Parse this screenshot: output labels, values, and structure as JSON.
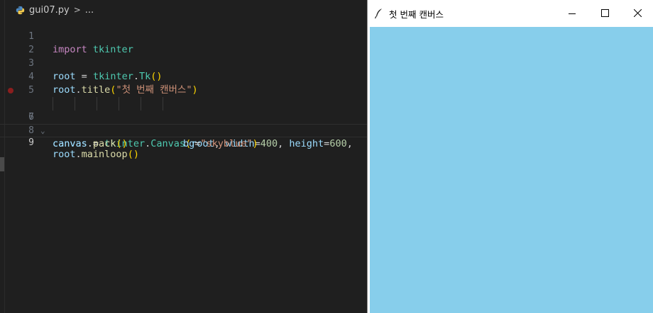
{
  "editor": {
    "breadcrumb": {
      "file": "gui07.py",
      "separator": ">",
      "rest": "..."
    },
    "lines": [
      {
        "n": "1"
      },
      {
        "n": "2"
      },
      {
        "n": "3"
      },
      {
        "n": "4"
      },
      {
        "n": "5"
      },
      {
        "n": "6"
      },
      {
        "n": "7"
      },
      {
        "n": "8"
      },
      {
        "n": "9"
      }
    ],
    "code": {
      "l1": {
        "kw": "import",
        "mod": "tkinter"
      },
      "l3": {
        "var": "root",
        "op": "=",
        "mod": "tkinter",
        "fn": "Tk",
        "paren": "()"
      },
      "l4": {
        "var": "root",
        "fn": "title",
        "str": "\"첫 번째 캔버스\""
      },
      "l6": {
        "var": "canvas",
        "op": "=",
        "mod": "tkinter",
        "fn": "Canvas",
        "arg1": "root",
        "k1": "width",
        "v1": "400",
        "k2": "height",
        "v2": "600"
      },
      "l7": {
        "k3": "bg",
        "str": "\"skyblue\""
      },
      "l8": {
        "var": "canvas",
        "fn": "pack",
        "paren": "()"
      },
      "l9": {
        "var": "root",
        "fn": "mainloop",
        "paren": "()"
      }
    }
  },
  "tk_window": {
    "title": "첫 번째 캔버스",
    "canvas_bg": "#87ceeb",
    "controls": {
      "minimize": "minimize-icon",
      "maximize": "maximize-icon",
      "close": "close-icon"
    }
  }
}
